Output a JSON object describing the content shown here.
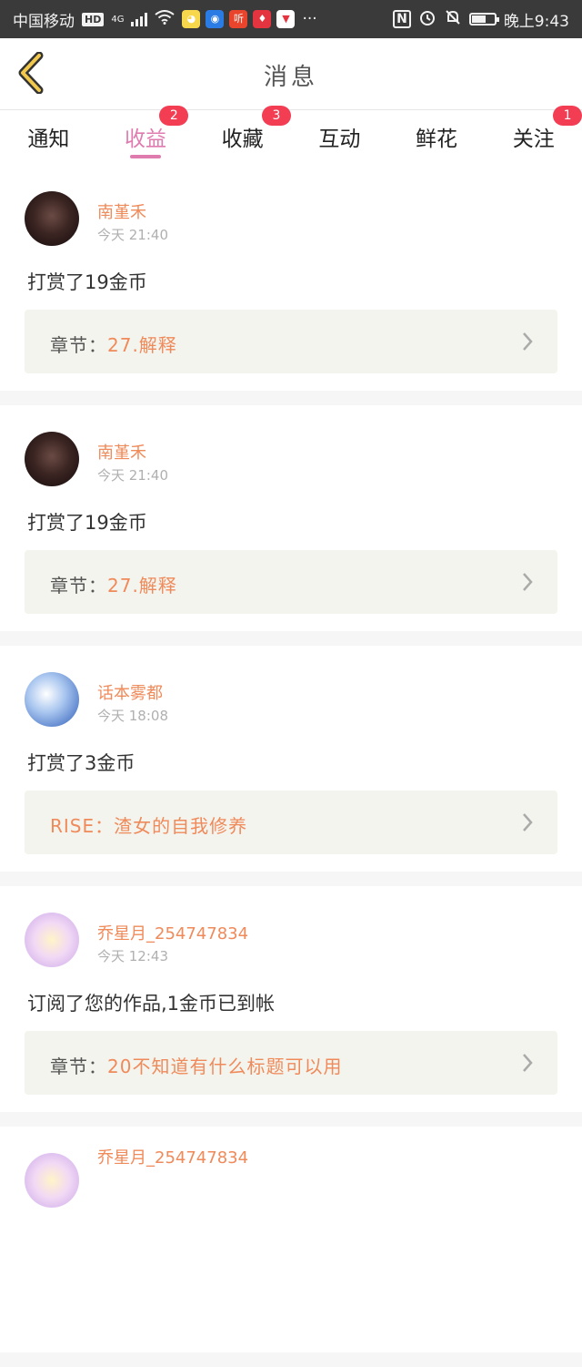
{
  "status_bar": {
    "carrier": "中国移动",
    "hd": "HD",
    "network": "4G",
    "app_icons": [
      {
        "name": "qq-app-icon",
        "color": "#f7d74c",
        "glyph": "◕"
      },
      {
        "name": "browser-app-icon",
        "color": "#2b7be4",
        "glyph": "◉"
      },
      {
        "name": "listen-app-icon",
        "color": "#e8452c",
        "glyph": "听"
      },
      {
        "name": "huawei-app-icon",
        "color": "#e3343f",
        "glyph": "♦"
      },
      {
        "name": "pin-app-icon",
        "color": "#ffffff",
        "glyph": "▼"
      }
    ],
    "more": "···",
    "time": "晚上9:43"
  },
  "header": {
    "title": "消息"
  },
  "tabs": [
    {
      "label": "通知",
      "badge": "",
      "active": false
    },
    {
      "label": "收益",
      "badge": "2",
      "active": true
    },
    {
      "label": "收藏",
      "badge": "3",
      "active": false
    },
    {
      "label": "互动",
      "badge": "",
      "active": false
    },
    {
      "label": "鲜花",
      "badge": "",
      "active": false
    },
    {
      "label": "关注",
      "badge": "1",
      "active": false
    }
  ],
  "messages": [
    {
      "author": "南堇禾",
      "time": "今天 21:40",
      "text": "打赏了19金币",
      "ref_label": "章节：",
      "ref_value": "27.解释",
      "avatar": "avatar-dark"
    },
    {
      "author": "南堇禾",
      "time": "今天 21:40",
      "text": "打赏了19金币",
      "ref_label": "章节：",
      "ref_value": "27.解释",
      "avatar": "avatar-dark"
    },
    {
      "author": "话本雾都",
      "time": "今天 18:08",
      "text": "打赏了3金币",
      "ref_label": "",
      "ref_value": "RISE：渣女的自我修养",
      "avatar": "avatar-blue"
    },
    {
      "author": "乔星月_254747834",
      "time": "今天 12:43",
      "text": "订阅了您的作品,1金币已到帐",
      "ref_label": "章节：",
      "ref_value": "20不知道有什么标题可以用",
      "avatar": "avatar-pastel"
    },
    {
      "author": "乔星月_254747834",
      "time": "",
      "text": "",
      "ref_label": "",
      "ref_value": "",
      "avatar": "avatar-pastel"
    }
  ]
}
